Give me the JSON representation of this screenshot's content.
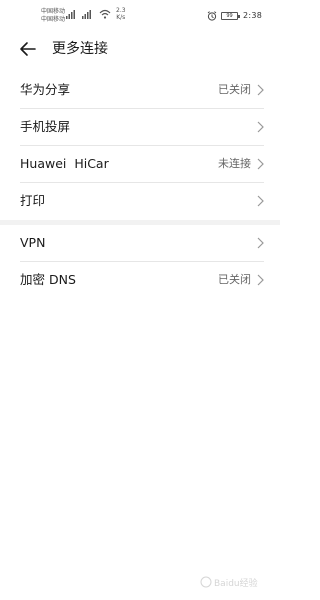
{
  "status_bar": {
    "carrier_1": "中国移动",
    "carrier_2": "中国移动",
    "net_speed_value": "2.3",
    "net_speed_unit": "K/s",
    "battery": "99",
    "time": "2:38"
  },
  "header": {
    "back_icon": "back-arrow-icon",
    "title": "更多连接"
  },
  "sections": [
    {
      "items": [
        {
          "label": "华为分享",
          "status": "已关闭"
        },
        {
          "label": "手机投屏",
          "status": ""
        },
        {
          "label": "Huawei  HiCar",
          "status": "未连接"
        },
        {
          "label": "打印",
          "status": ""
        }
      ]
    },
    {
      "items": [
        {
          "label": "VPN",
          "status": ""
        },
        {
          "label": "加密 DNS",
          "status": "已关闭"
        }
      ]
    }
  ],
  "watermark_text": "Baidu经验"
}
